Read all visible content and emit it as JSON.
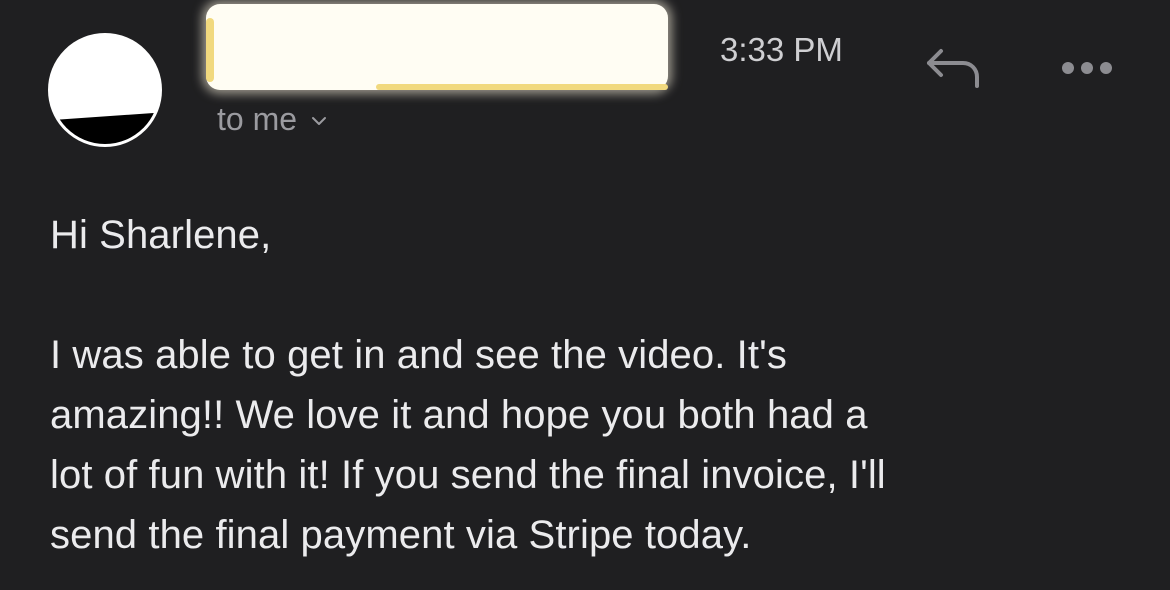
{
  "email": {
    "time": "3:33 PM",
    "recipient_label": "to me",
    "greeting": "Hi Sharlene,",
    "body_lines": [
      "I was able to get in and see the video. It's",
      "amazing!! We love it and hope you both had a",
      "lot of fun with it! If you send the final invoice, I'll",
      "send the final payment via Stripe today."
    ]
  },
  "icons": {
    "reply": "reply-icon",
    "more": "more-icon",
    "chevron": "chevron-down-icon"
  }
}
